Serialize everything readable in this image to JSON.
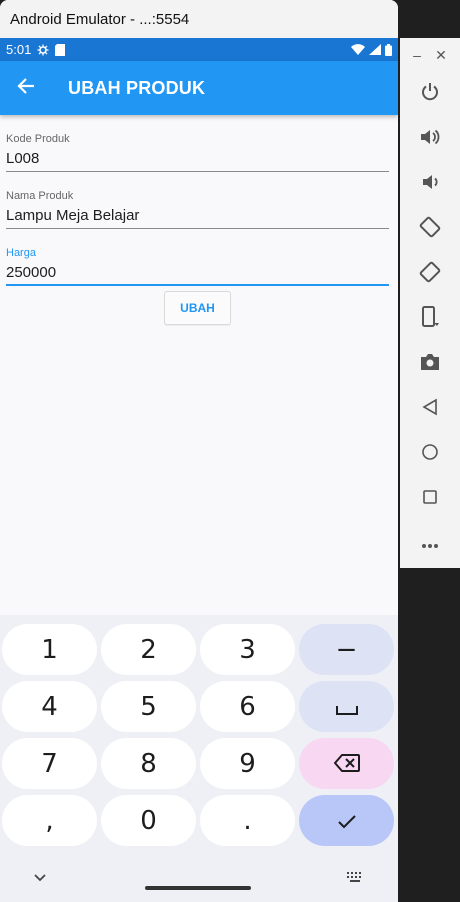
{
  "window": {
    "title": "Android Emulator - ...:5554"
  },
  "status_bar": {
    "time": "5:01"
  },
  "app_bar": {
    "title": "UBAH PRODUK"
  },
  "form": {
    "fields": [
      {
        "label": "Kode Produk",
        "value": "L008"
      },
      {
        "label": "Nama Produk",
        "value": "Lampu Meja Belajar"
      },
      {
        "label": "Harga",
        "value": "250000"
      }
    ],
    "submit_label": "UBAH"
  },
  "keyboard": {
    "keys": [
      "1",
      "2",
      "3",
      "−",
      "4",
      "5",
      "6",
      "",
      "7",
      "8",
      "9",
      "",
      ",",
      "0",
      ".",
      ""
    ]
  },
  "colors": {
    "status_bar": "#1976d2",
    "app_bar": "#2196f3",
    "accent": "#2196f3",
    "delete_key": "#f8d7f2",
    "enter_key": "#b8c7f7"
  },
  "toolbar": {
    "icons": [
      "power-icon",
      "volume-up-icon",
      "volume-down-icon",
      "rotate-left-icon",
      "rotate-right-icon",
      "fold-device-icon",
      "camera-icon",
      "back-icon",
      "home-icon",
      "overview-icon",
      "more-icon"
    ]
  }
}
